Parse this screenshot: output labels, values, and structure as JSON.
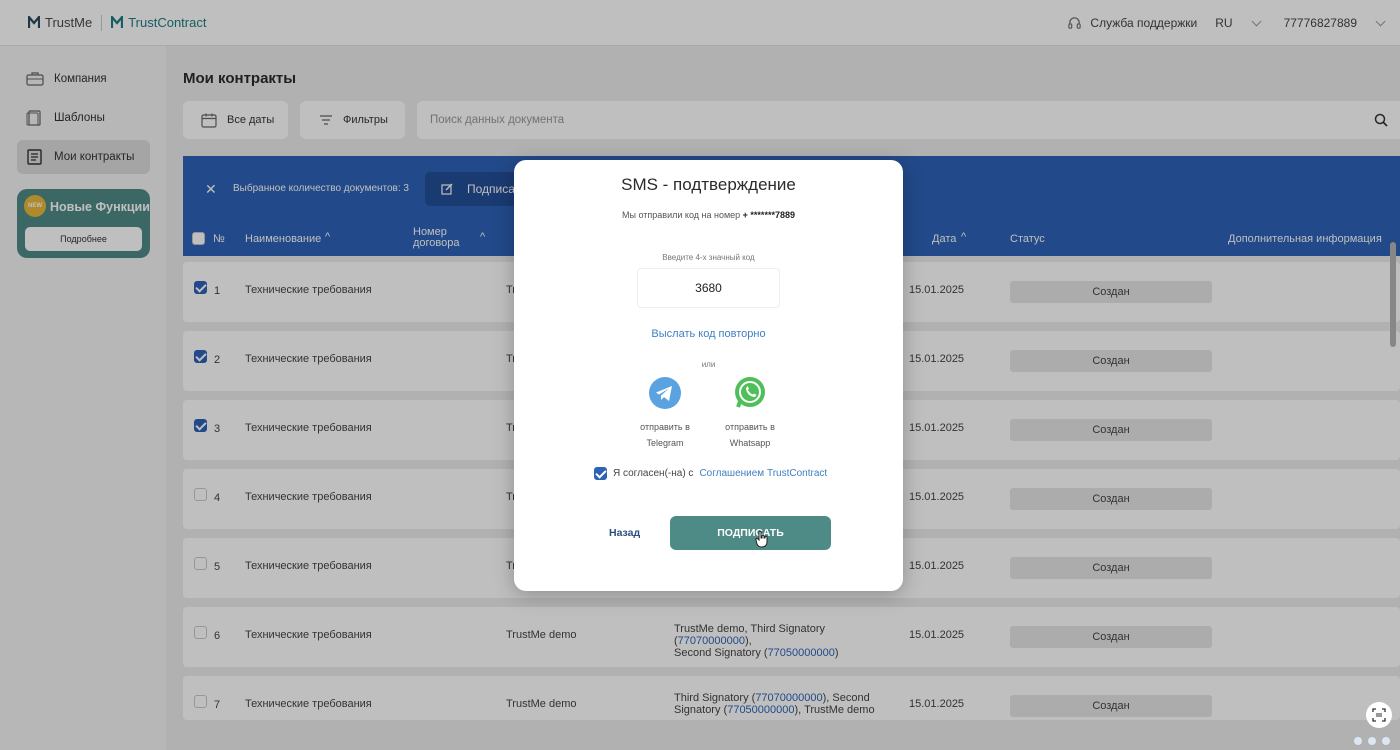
{
  "header": {
    "brand1": "TrustMe",
    "brand2": "TrustContract",
    "support": "Служба поддержки",
    "lang": "RU",
    "phone": "77776827889"
  },
  "sidebar": {
    "items": [
      {
        "label": "Компания",
        "icon": "briefcase-icon"
      },
      {
        "label": "Шаблоны",
        "icon": "templates-icon"
      },
      {
        "label": "Мои контракты",
        "icon": "document-icon"
      }
    ],
    "new_features": {
      "badge": "NEW",
      "title": "Новые Функции",
      "more": "Подробнее"
    }
  },
  "main": {
    "title": "Мои контракты",
    "all_dates": "Все даты",
    "filters": "Фильтры",
    "search_placeholder": "Поиск данных документа"
  },
  "selection_bar": {
    "text": "Выбранное количество документов: 3",
    "sign_label": "Подписать"
  },
  "table": {
    "headers": {
      "num": "№",
      "name": "Наименование",
      "contract_no": "Номер договора",
      "date": "Дата",
      "status": "Статус",
      "extra": "Дополнительная информация"
    },
    "rows": [
      {
        "num": "1",
        "name": "Технические требования",
        "org": "Tr",
        "sig": "",
        "date": "15.01.2025",
        "status": "Создан",
        "checked": true
      },
      {
        "num": "2",
        "name": "Технические требования",
        "org": "Tr",
        "sig": "",
        "date": "15.01.2025",
        "status": "Создан",
        "checked": true
      },
      {
        "num": "3",
        "name": "Технические требования",
        "org": "Tr",
        "sig": "",
        "date": "15.01.2025",
        "status": "Создан",
        "checked": true
      },
      {
        "num": "4",
        "name": "Технические требования",
        "org": "Tr",
        "sig": "",
        "date": "15.01.2025",
        "status": "Создан",
        "checked": false
      },
      {
        "num": "5",
        "name": "Технические требования",
        "org": "Tr",
        "sig": "",
        "date": "15.01.2025",
        "status": "Создан",
        "checked": false
      },
      {
        "num": "6",
        "name": "Технические требования",
        "org": "TrustMe demo",
        "sig1": "TrustMe demo, Third Signatory (",
        "p1": "77070000000",
        "sig2": "),",
        "sig3": "Second Signatory (",
        "p2": "77050000000",
        "sig4": ")",
        "date": "15.01.2025",
        "status": "Создан",
        "checked": false
      },
      {
        "num": "7",
        "name": "Технические требования",
        "org": "TrustMe demo",
        "sig1": "Third Signatory (",
        "p1": "77070000000",
        "sig2": "), Second",
        "sig3": "Signatory (",
        "p2": "77050000000",
        "sig4": "), TrustMe demo",
        "date": "15.01.2025",
        "status": "Создан",
        "checked": false
      }
    ]
  },
  "modal": {
    "title": "SMS - подтверждение",
    "sent_prefix": "Мы отправили код на номер",
    "masked_phone": "+ *******7889",
    "code_hint": "Введите 4-х значный код",
    "code_value": "3680",
    "resend": "Выслать код повторно",
    "or": "или",
    "telegram_line1": "отправить в",
    "telegram_line2": "Telegram",
    "whatsapp_line1": "отправить в",
    "whatsapp_line2": "Whatsapp",
    "agree_text": "Я согласен(-на) с",
    "agree_link": "Соглашением TrustContract",
    "agree_checked": true,
    "back": "Назад",
    "sign": "ПОДПИСАТЬ"
  },
  "colors": {
    "primary_blue": "#2e62b7",
    "teal": "#4f8b86",
    "link_blue": "#3f7fc2"
  }
}
